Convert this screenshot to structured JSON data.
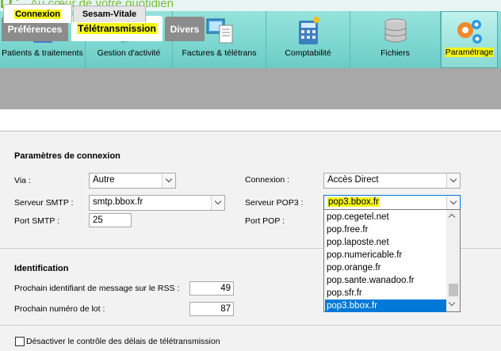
{
  "banner": {
    "logo": "LC",
    "tagline": "Au cœur de votre quotidien"
  },
  "nav": [
    {
      "label": "Patients & traitements",
      "icon": "patients-icon"
    },
    {
      "label": "Gestion d'activité",
      "icon": "activity-icon"
    },
    {
      "label": "Factures & télétrans",
      "icon": "invoices-icon"
    },
    {
      "label": "Comptabilité",
      "icon": "accounting-icon"
    },
    {
      "label": "Fichiers",
      "icon": "database-icon"
    },
    {
      "label": "Paramétrage",
      "icon": "gears-icon",
      "active": true
    }
  ],
  "main_tabs": [
    {
      "label": "Préférences"
    },
    {
      "label": "Télétransmission",
      "active": true
    },
    {
      "label": "Divers"
    }
  ],
  "sub_tabs": [
    {
      "label": "Connexion",
      "active": true
    },
    {
      "label": "Sesam-Vitale"
    }
  ],
  "connexion": {
    "section_title": "Paramètres de connexion",
    "via_label": "Via :",
    "via_value": "Autre",
    "smtp_label": "Serveur SMTP :",
    "smtp_value": "smtp.bbox.fr",
    "port_smtp_label": "Port SMTP :",
    "port_smtp_value": "25",
    "connexion_label": "Connexion :",
    "connexion_value": "Accès Direct",
    "pop3_label": "Serveur POP3 :",
    "pop3_value": "pop3.bbox.fr",
    "port_pop_label": "Port POP :",
    "pop3_options": [
      "pop.cegetel.net",
      "pop.free.fr",
      "pop.laposte.net",
      "pop.numericable.fr",
      "pop.orange.fr",
      "pop.sante.wanadoo.fr",
      "pop.sfr.fr",
      "pop3.bbox.fr"
    ],
    "pop3_selected_index": 7
  },
  "identification": {
    "section_title": "Identification",
    "next_msg_label": "Prochain identifiant de message sur le RSS :",
    "next_msg_value": "49",
    "next_lot_label": "Prochain numéro de lot :",
    "next_lot_value": "87"
  },
  "disable_check_label": "Désactiver le contrôle des délais de télétransmission",
  "colors": {
    "accent": "#7fd8d2",
    "highlight": "#f4f51a",
    "selection": "#0078d7"
  }
}
